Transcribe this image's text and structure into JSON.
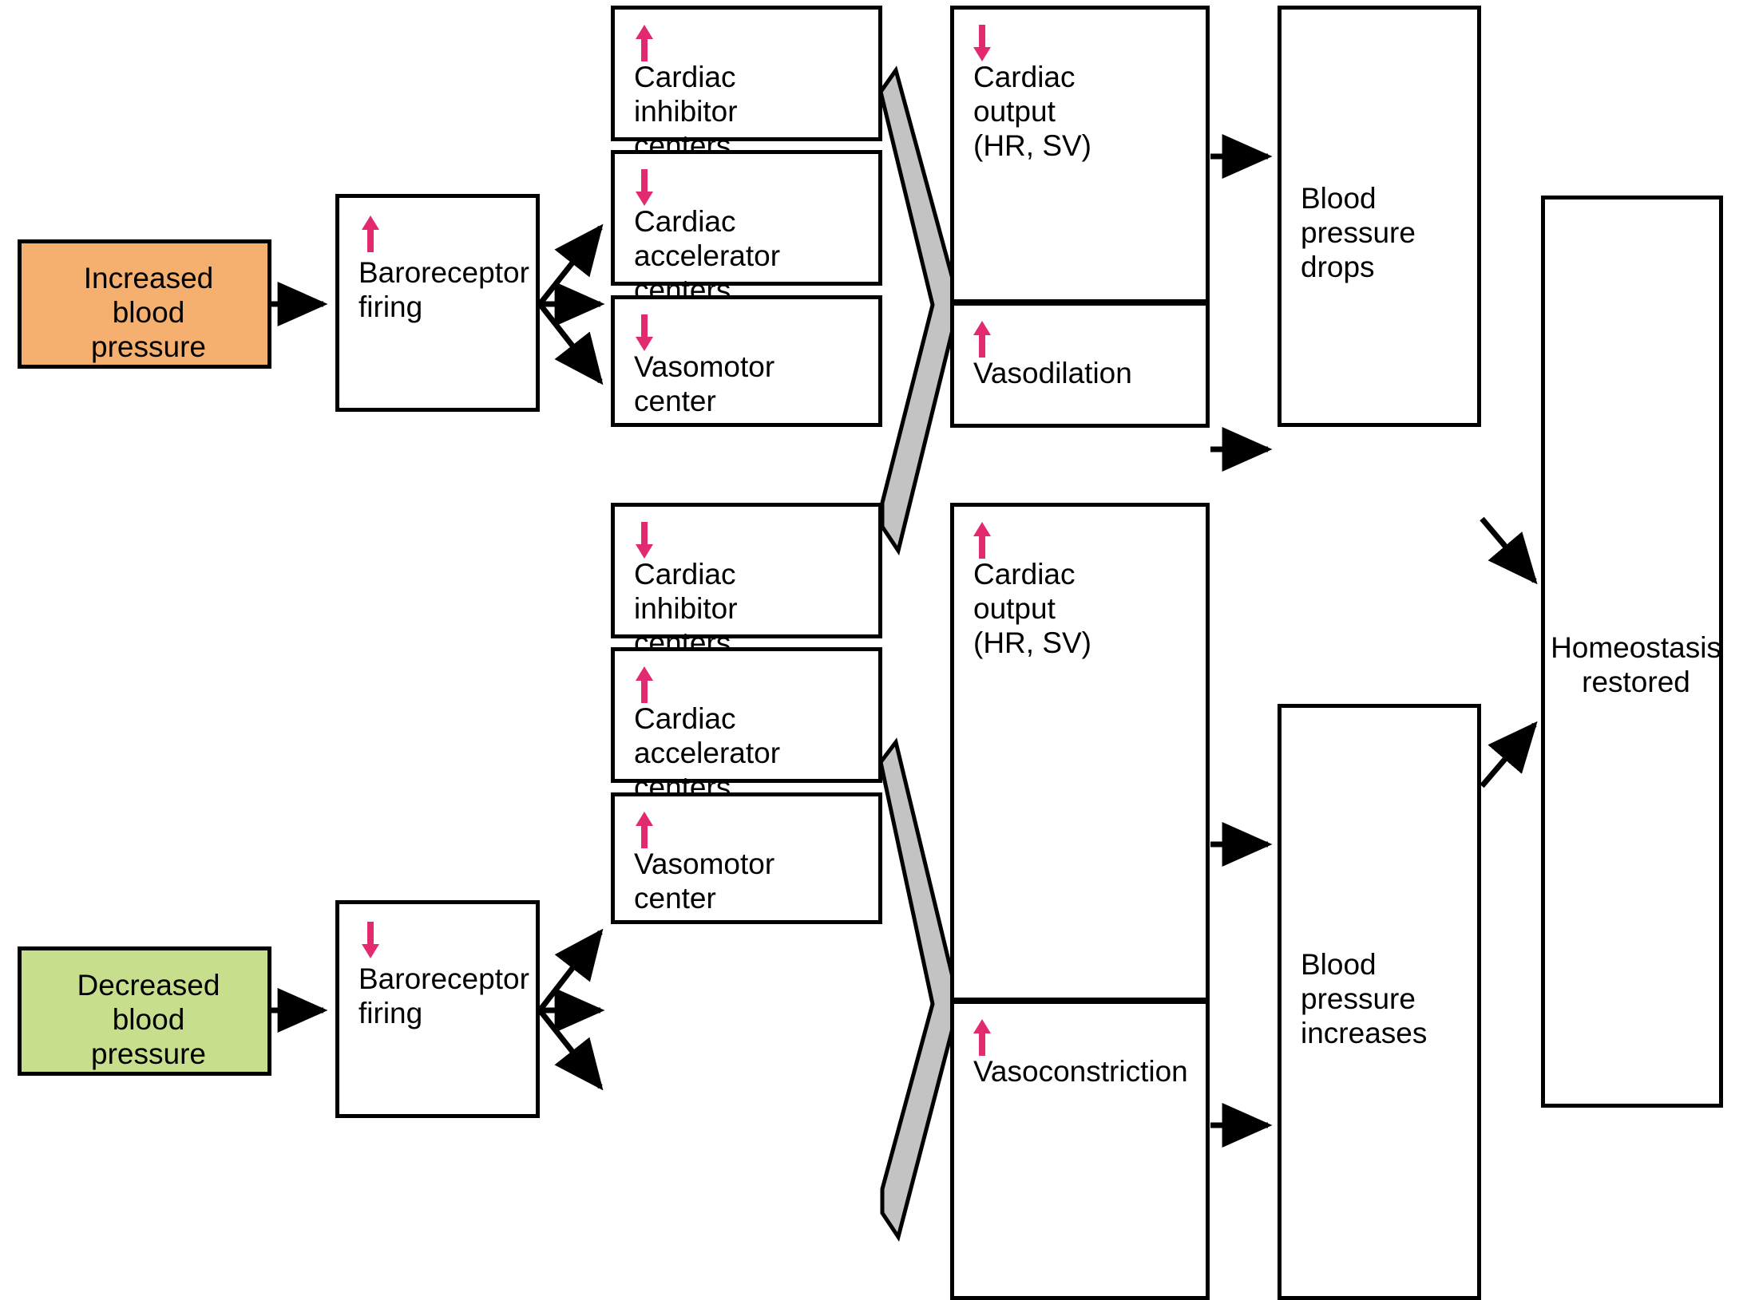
{
  "colors": {
    "increased_box_fill": "#F5AF6E",
    "decreased_box_fill": "#C7DE8C",
    "arrow_pink": "#E22A70",
    "funnel_gray": "#C3C3C3",
    "outline": "#000000",
    "page_background": "#FFFFFF"
  },
  "icons": {
    "up": "arrow-up-icon",
    "down": "arrow-down-icon",
    "flow": "flow-arrow-icon"
  },
  "top_pathway": {
    "stimulus": {
      "label": "Increased\nblood\npressure"
    },
    "baroreceptor": {
      "label": "Baroreceptor\nfiring",
      "trend": "up"
    },
    "centers": [
      {
        "label": "Cardiac\ninhibitor\ncenters",
        "trend": "up"
      },
      {
        "label": "Cardiac\naccelerator\ncenters",
        "trend": "down"
      },
      {
        "label": "Vasomotor\ncenter",
        "trend": "down"
      }
    ],
    "effects": [
      {
        "label": "Cardiac\noutput\n(HR, SV)",
        "trend": "down"
      },
      {
        "label": "Vasodilation",
        "trend": "up"
      }
    ],
    "outcome": {
      "label": "Blood\npressure\ndrops"
    }
  },
  "bottom_pathway": {
    "stimulus": {
      "label": "Decreased\nblood\npressure"
    },
    "baroreceptor": {
      "label": "Baroreceptor\nfiring",
      "trend": "down"
    },
    "centers": [
      {
        "label": "Cardiac\ninhibitor\ncenters",
        "trend": "down"
      },
      {
        "label": "Cardiac\naccelerator\ncenters",
        "trend": "up"
      },
      {
        "label": "Vasomotor\ncenter",
        "trend": "up"
      }
    ],
    "effects": [
      {
        "label": "Cardiac\noutput\n(HR, SV)",
        "trend": "up"
      },
      {
        "label": "Vasoconstriction",
        "trend": "up"
      }
    ],
    "outcome": {
      "label": "Blood\npressure\nincreases"
    }
  },
  "final": {
    "label": "Homeostasis\nrestored"
  }
}
